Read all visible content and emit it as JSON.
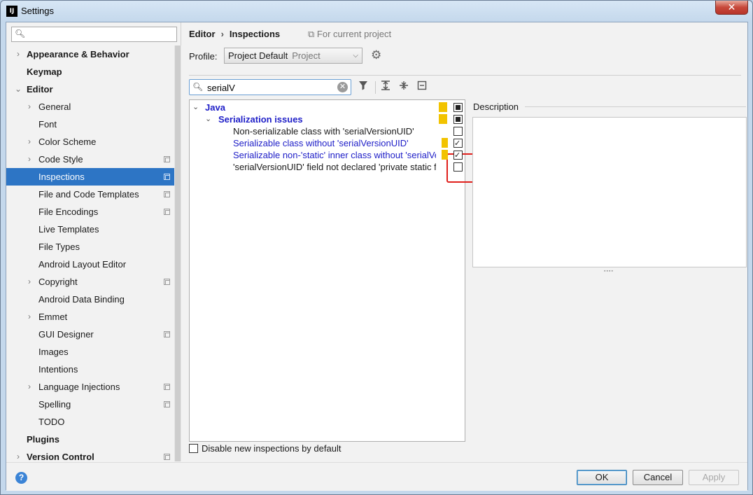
{
  "window": {
    "title": "Settings",
    "close_label": "✕",
    "app_icon_text": "IJ"
  },
  "sidebar": {
    "search_placeholder": "",
    "items": [
      {
        "label": "Appearance & Behavior",
        "level": 0,
        "bold": true,
        "arrow": "›",
        "copy": false
      },
      {
        "label": "Keymap",
        "level": 0,
        "bold": true,
        "arrow": "",
        "copy": false
      },
      {
        "label": "Editor",
        "level": 0,
        "bold": true,
        "arrow": "⌄",
        "copy": false
      },
      {
        "label": "General",
        "level": 1,
        "arrow": "›",
        "copy": false
      },
      {
        "label": "Font",
        "level": 1,
        "arrow": "",
        "copy": false
      },
      {
        "label": "Color Scheme",
        "level": 1,
        "arrow": "›",
        "copy": false
      },
      {
        "label": "Code Style",
        "level": 1,
        "arrow": "›",
        "copy": true
      },
      {
        "label": "Inspections",
        "level": 1,
        "arrow": "",
        "copy": true,
        "selected": true
      },
      {
        "label": "File and Code Templates",
        "level": 1,
        "arrow": "",
        "copy": true
      },
      {
        "label": "File Encodings",
        "level": 1,
        "arrow": "",
        "copy": true
      },
      {
        "label": "Live Templates",
        "level": 1,
        "arrow": "",
        "copy": false
      },
      {
        "label": "File Types",
        "level": 1,
        "arrow": "",
        "copy": false
      },
      {
        "label": "Android Layout Editor",
        "level": 1,
        "arrow": "",
        "copy": false
      },
      {
        "label": "Copyright",
        "level": 1,
        "arrow": "›",
        "copy": true
      },
      {
        "label": "Android Data Binding",
        "level": 1,
        "arrow": "",
        "copy": false
      },
      {
        "label": "Emmet",
        "level": 1,
        "arrow": "›",
        "copy": false
      },
      {
        "label": "GUI Designer",
        "level": 1,
        "arrow": "",
        "copy": true
      },
      {
        "label": "Images",
        "level": 1,
        "arrow": "",
        "copy": false
      },
      {
        "label": "Intentions",
        "level": 1,
        "arrow": "",
        "copy": false
      },
      {
        "label": "Language Injections",
        "level": 1,
        "arrow": "›",
        "copy": true
      },
      {
        "label": "Spelling",
        "level": 1,
        "arrow": "",
        "copy": true
      },
      {
        "label": "TODO",
        "level": 1,
        "arrow": "",
        "copy": false
      },
      {
        "label": "Plugins",
        "level": 0,
        "bold": true,
        "arrow": "",
        "copy": false
      },
      {
        "label": "Version Control",
        "level": 0,
        "bold": true,
        "arrow": "›",
        "copy": true
      }
    ]
  },
  "header": {
    "breadcrumb": [
      "Editor",
      "Inspections"
    ],
    "breadcrumb_sep": "›",
    "project_note": "For current project",
    "project_note_icon": "⧉"
  },
  "profile": {
    "label": "Profile:",
    "value": "Project Default",
    "scope": "Project"
  },
  "filter": {
    "value": "serialV",
    "clear_label": "✕"
  },
  "inspections": [
    {
      "label": "Java",
      "depth": 0,
      "type": "group",
      "arrow": "⌄",
      "severity": true,
      "check": "partial"
    },
    {
      "label": "Serialization issues",
      "depth": 1,
      "type": "group",
      "arrow": "⌄",
      "severity": true,
      "check": "partial"
    },
    {
      "label": "Non-serializable class with 'serialVersionUID'",
      "depth": 2,
      "type": "plain",
      "severity": false,
      "check": "unchecked"
    },
    {
      "label": "Serializable class without 'serialVersionUID'",
      "depth": 2,
      "type": "blue",
      "severity": true,
      "check": "checked"
    },
    {
      "label": "Serializable non-'static' inner class without 'serialVersionUID'",
      "depth": 2,
      "type": "blue",
      "severity": true,
      "check": "checked"
    },
    {
      "label": "'serialVersionUID' field not declared 'private static final long'",
      "depth": 2,
      "type": "plain",
      "severity": false,
      "check": "unchecked"
    }
  ],
  "description": {
    "title": "Description",
    "content": ""
  },
  "options": {
    "disable_new_label": "Disable new inspections by default",
    "disable_new_checked": false
  },
  "footer": {
    "help_label": "?",
    "ok_label": "OK",
    "cancel_label": "Cancel",
    "apply_label": "Apply"
  },
  "colors": {
    "selection": "#2d75c5",
    "severity_warning": "#f2c300",
    "highlight_box": "#e0201c",
    "blue_text": "#2020c8"
  }
}
